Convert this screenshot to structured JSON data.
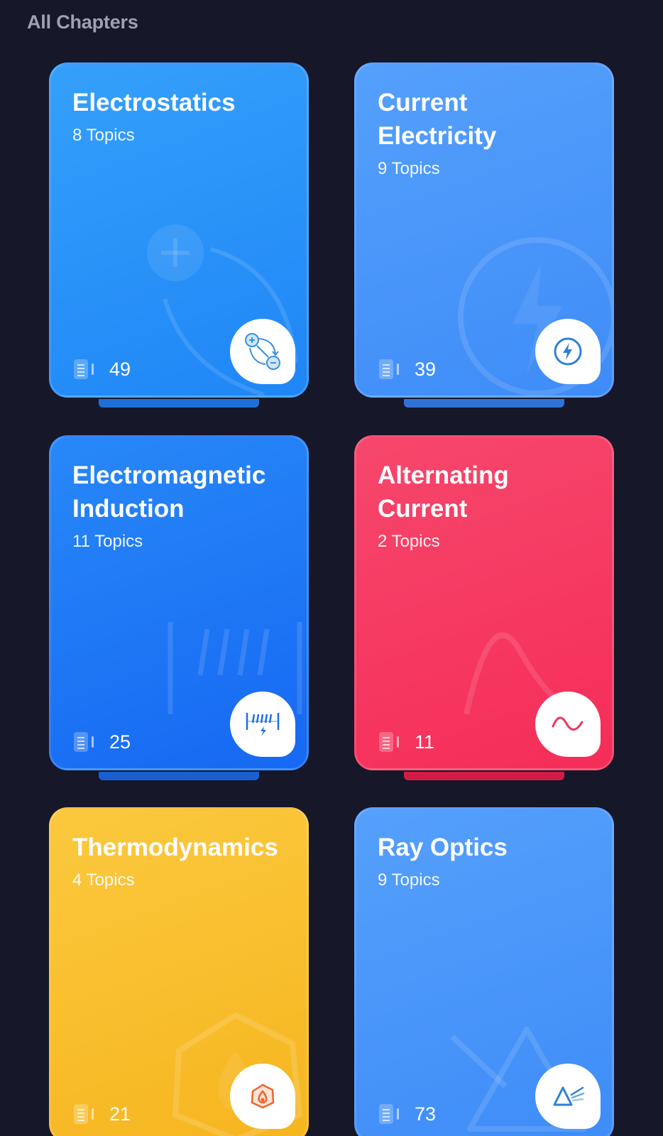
{
  "header": {
    "title": "All Chapters"
  },
  "chapters": [
    {
      "title": "Electrostatics",
      "topics": "8 Topics",
      "count": "49",
      "icon": "charges-icon",
      "color": "#2f95fa"
    },
    {
      "title": "Current Electricity",
      "topics": "9 Topics",
      "count": "39",
      "icon": "lightning-icon",
      "color": "#4a95fb"
    },
    {
      "title": "Electromagnetic Induction",
      "topics": "11 Topics",
      "count": "25",
      "icon": "coil-icon",
      "color": "#2077f7"
    },
    {
      "title": "Alternating Current",
      "topics": "2 Topics",
      "count": "11",
      "icon": "sine-wave-icon",
      "color": "#f53860"
    },
    {
      "title": "Thermodynamics",
      "topics": "4 Topics",
      "count": "21",
      "icon": "flame-icon",
      "color": "#f7bd2a"
    },
    {
      "title": "Ray Optics",
      "topics": "9 Topics",
      "count": "73",
      "icon": "prism-icon",
      "color": "#4a95fb"
    }
  ]
}
